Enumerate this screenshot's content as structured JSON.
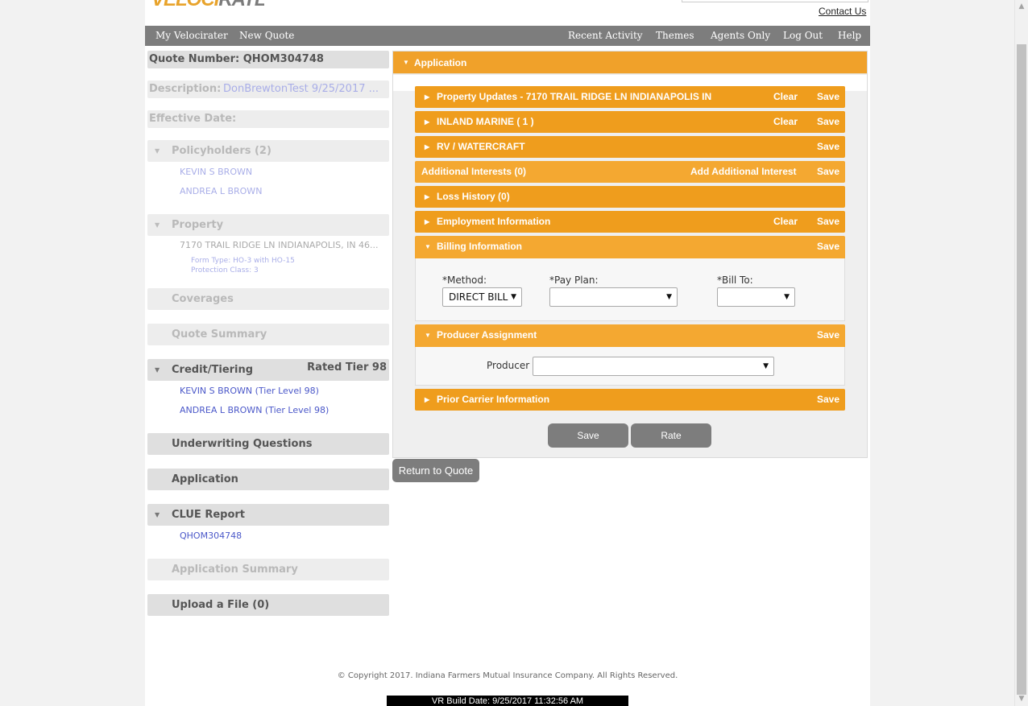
{
  "header": {
    "logo_part1": "VELOCI",
    "logo_part2": "RATER",
    "contact": "Contact Us"
  },
  "nav": {
    "left": [
      "My Velocirater",
      "New Quote"
    ],
    "right": [
      "Recent Activity",
      "Themes",
      "Agents Only",
      "Log Out",
      "Help"
    ]
  },
  "sidebar": {
    "quote_number": "Quote Number: QHOM304748",
    "description_label": "Description:",
    "description_value": "DonBrewtonTest 9/25/2017 ...",
    "effective_date": "Effective Date:",
    "policyholders": {
      "title": "Policyholders (2)",
      "items": [
        "KEVIN S BROWN",
        "ANDREA L BROWN"
      ]
    },
    "property": {
      "title": "Property",
      "address": "7170 TRAIL RIDGE LN INDIANAPOLIS, IN 46...",
      "form_type": "Form Type: HO-3 with HO-15",
      "protection_class": "Protection Class: 3"
    },
    "coverages": "Coverages",
    "quote_summary": "Quote Summary",
    "credit": {
      "title": "Credit/Tiering",
      "rated": "Rated Tier 98",
      "items": [
        "KEVIN S BROWN (Tier Level 98)",
        "ANDREA L BROWN (Tier Level 98)"
      ]
    },
    "underwriting": "Underwriting Questions",
    "application": "Application",
    "clue": {
      "title": "CLUE Report",
      "item": "QHOM304748"
    },
    "application_summary": "Application Summary",
    "upload": "Upload a File (0)"
  },
  "application": {
    "title": "Application",
    "sections": {
      "property_updates": {
        "title": "Property Updates - 7170 TRAIL RIDGE LN INDIANAPOLIS IN",
        "clear": "Clear",
        "save": "Save"
      },
      "inland_marine": {
        "title": "INLAND MARINE ( 1 )",
        "clear": "Clear",
        "save": "Save"
      },
      "rv_watercraft": {
        "title": "RV / WATERCRAFT",
        "save": "Save"
      },
      "additional_interests": {
        "title": "Additional Interests (0)",
        "add": "Add Additional Interest",
        "save": "Save"
      },
      "loss_history": {
        "title": "Loss History (0)"
      },
      "employment": {
        "title": "Employment Information",
        "clear": "Clear",
        "save": "Save"
      },
      "billing": {
        "title": "Billing Information",
        "save": "Save",
        "method_label": "*Method:",
        "method_value": "DIRECT BILL",
        "pay_plan_label": "*Pay Plan:",
        "pay_plan_value": "",
        "bill_to_label": "*Bill To:",
        "bill_to_value": ""
      },
      "producer_assignment": {
        "title": "Producer Assignment",
        "save": "Save",
        "producer_label": "Producer",
        "producer_value": ""
      },
      "prior_carrier": {
        "title": "Prior Carrier Information",
        "save": "Save"
      }
    },
    "buttons": {
      "save": "Save",
      "rate": "Rate"
    },
    "return_to_quote": "Return to Quote"
  },
  "footer": {
    "copyright": "© Copyright 2017. Indiana Farmers Mutual Insurance Company. All Rights Reserved.",
    "build": "VR Build Date: 9/25/2017 11:32:56 AM"
  },
  "colors": {
    "accent": "#ef9d1d",
    "nav": "#7d7d7d",
    "link": "#4b58c9"
  }
}
